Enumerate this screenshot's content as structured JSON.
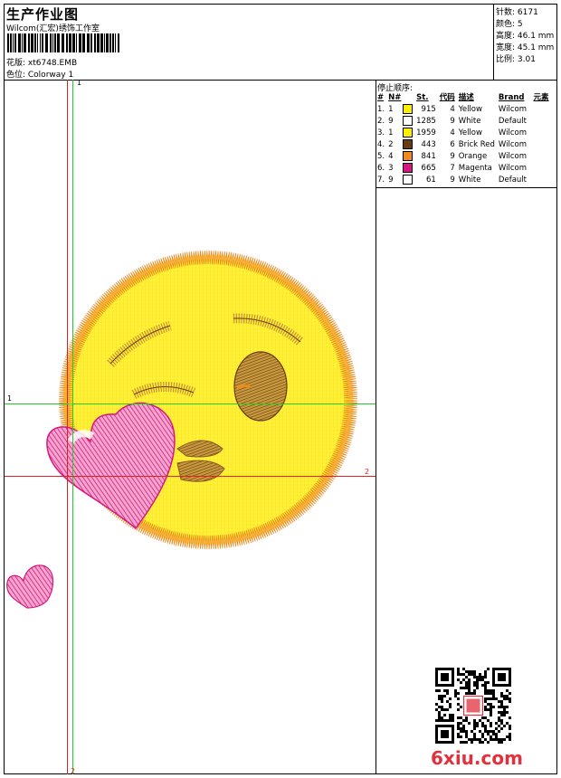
{
  "header": {
    "title": "生产作业图",
    "studio": "Wilcom(汇宏)绣饰工作室",
    "design_label": "花版: xt6748.EMB",
    "colorway_label": "色位: Colorway 1"
  },
  "stats": {
    "stitches": "针数: 6171",
    "colors": "颜色: 5",
    "height": "高度: 46.1 mm",
    "width": "宽度: 45.1 mm",
    "scale": "比例: 3.01"
  },
  "stops": {
    "title": "停止顺序:",
    "columns": [
      "#",
      "N#",
      "St.",
      "代码",
      "描述",
      "Brand",
      "元素"
    ],
    "rows": [
      {
        "idx": "1.",
        "n": "1",
        "st": "915",
        "code": "4",
        "desc": "Yellow",
        "brand": "Wilcom",
        "color": "#ffee00"
      },
      {
        "idx": "2.",
        "n": "9",
        "st": "1285",
        "code": "9",
        "desc": "White",
        "brand": "Default",
        "color": "#ffffff"
      },
      {
        "idx": "3.",
        "n": "1",
        "st": "1959",
        "code": "4",
        "desc": "Yellow",
        "brand": "Wilcom",
        "color": "#ffee00"
      },
      {
        "idx": "4.",
        "n": "2",
        "st": "443",
        "code": "6",
        "desc": "Brick Red",
        "brand": "Wilcom",
        "color": "#6b3a10"
      },
      {
        "idx": "5.",
        "n": "4",
        "st": "841",
        "code": "9",
        "desc": "Orange",
        "brand": "Wilcom",
        "color": "#f08a1e"
      },
      {
        "idx": "6.",
        "n": "3",
        "st": "665",
        "code": "7",
        "desc": "Magenta",
        "brand": "Wilcom",
        "color": "#d6177f"
      },
      {
        "idx": "7.",
        "n": "9",
        "st": "61",
        "code": "9",
        "desc": "White",
        "brand": "Default",
        "color": "#ffffff"
      }
    ]
  },
  "guides": {
    "v_top": "1",
    "h_left": "1",
    "h2_right": "2",
    "v2_bottom": "2"
  },
  "watermark": "6xiu.com",
  "colors": {
    "yellow": "#ffee00",
    "orange": "#f08a1e",
    "brown": "#6b3a10",
    "magenta": "#d6177f",
    "guide_green": "#22cc22",
    "guide_red": "#dd2222"
  }
}
